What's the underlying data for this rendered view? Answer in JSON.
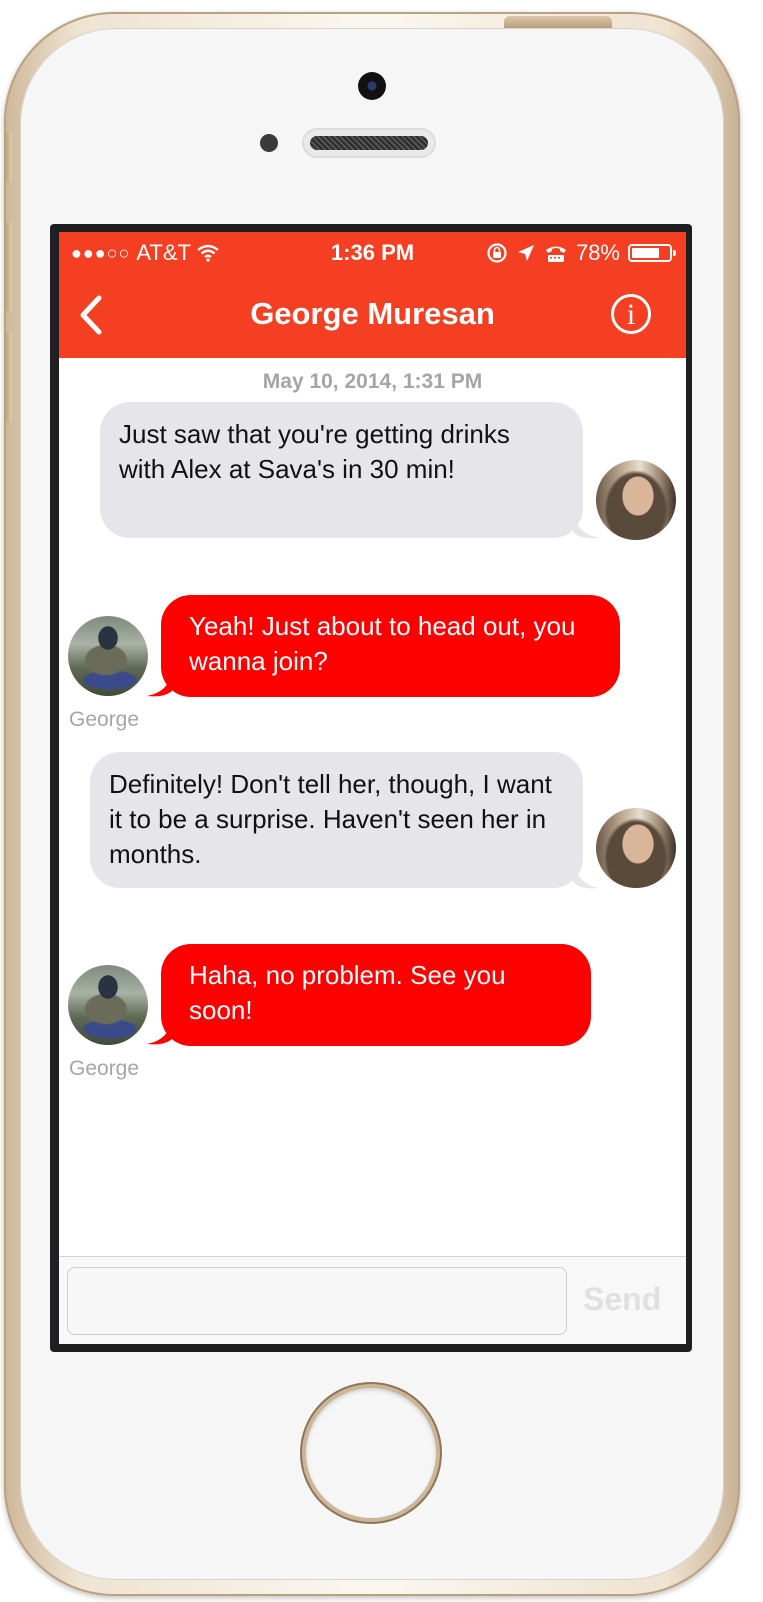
{
  "status_bar": {
    "signal": "●●●○○",
    "carrier": "AT&T",
    "time": "1:36 PM",
    "battery": "78%",
    "battery_level": 0.78
  },
  "nav": {
    "title": "George Muresan",
    "info": "i"
  },
  "timestamp": "May 10, 2014, 1:31 PM",
  "messages": [
    {
      "direction": "incoming",
      "text": "Just saw that you're getting drinks with Alex at Sava's in 30 min!"
    },
    {
      "direction": "outgoing",
      "text": "Yeah! Just about to head out, you wanna join?",
      "sender": "George"
    },
    {
      "direction": "incoming",
      "text": "Definitely! Don't tell her, though, I want it to be a surprise. Haven't seen her in months."
    },
    {
      "direction": "outgoing",
      "text": "Haha, no problem. See you soon!",
      "sender": "George"
    }
  ],
  "composer": {
    "placeholder": "",
    "send_label": "Send"
  },
  "colors": {
    "header": "#f43f22",
    "outgoing_bubble": "#fd0000",
    "incoming_bubble": "#e6e6ea"
  }
}
